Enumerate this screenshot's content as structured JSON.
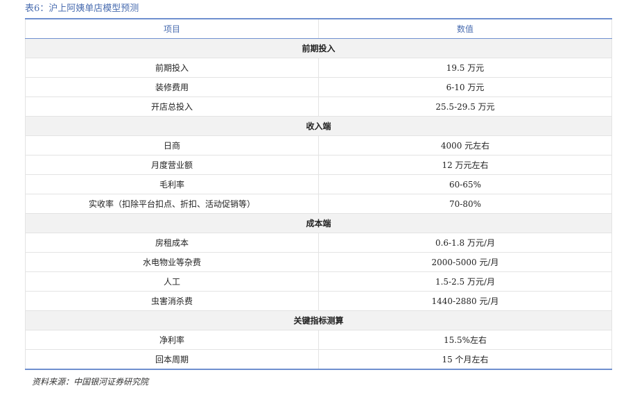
{
  "caption": "表6：沪上阿姨单店模型预测",
  "header": {
    "col1": "项目",
    "col2": "数值"
  },
  "sections": [
    {
      "title": "前期投入",
      "rows": [
        {
          "item": "前期投入",
          "value": "19.5 万元"
        },
        {
          "item": "装修费用",
          "value": "6-10 万元"
        },
        {
          "item": "开店总投入",
          "value": "25.5-29.5 万元"
        }
      ]
    },
    {
      "title": "收入端",
      "rows": [
        {
          "item": "日商",
          "value": "4000 元左右"
        },
        {
          "item": "月度营业额",
          "value": "12 万元左右"
        },
        {
          "item": "毛利率",
          "value": "60-65%"
        },
        {
          "item": "实收率（扣除平台扣点、折扣、活动促销等）",
          "value": "70-80%"
        }
      ]
    },
    {
      "title": "成本端",
      "rows": [
        {
          "item": "房租成本",
          "value": "0.6-1.8 万元/月"
        },
        {
          "item": "水电物业等杂费",
          "value": "2000-5000 元/月"
        },
        {
          "item": "人工",
          "value": "1.5-2.5 万元/月"
        },
        {
          "item": "虫害消杀费",
          "value": "1440-2880 元/月"
        }
      ]
    },
    {
      "title": "关键指标测算",
      "rows": [
        {
          "item": "净利率",
          "value": "15.5%左右"
        },
        {
          "item": "回本周期",
          "value": "15 个月左右"
        }
      ]
    }
  ],
  "source": "资料来源：中国银河证券研究院"
}
